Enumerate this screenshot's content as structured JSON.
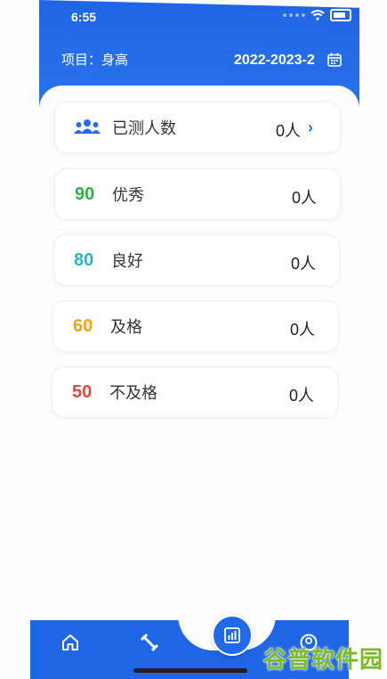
{
  "status_bar": {
    "time": "6:55"
  },
  "header": {
    "project_label": "项目：身高",
    "term": "2022-2023-2",
    "calendar_icon": "calendar-icon"
  },
  "summary": {
    "label": "已测人数",
    "count": "0人",
    "icon": "group-icon"
  },
  "grades": [
    {
      "score": "90",
      "label": "优秀",
      "count": "0人",
      "color": "#2fae4a"
    },
    {
      "score": "80",
      "label": "良好",
      "count": "0人",
      "color": "#2ab6c3"
    },
    {
      "score": "60",
      "label": "及格",
      "count": "0人",
      "color": "#f0a21c"
    },
    {
      "score": "50",
      "label": "不及格",
      "count": "0人",
      "color": "#e2493c"
    }
  ],
  "bottom_nav": {
    "items": [
      "home-icon",
      "fitness-icon",
      "report-icon",
      "profile-icon"
    ]
  },
  "watermark": "谷普软件园",
  "colors": {
    "primary": "#1f66e6"
  }
}
